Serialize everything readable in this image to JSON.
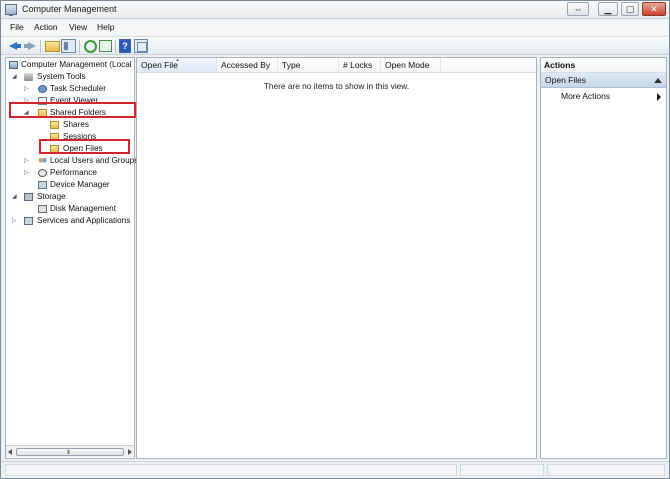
{
  "window": {
    "title": "Computer Management"
  },
  "menu": {
    "items": [
      "File",
      "Action",
      "View",
      "Help"
    ]
  },
  "toolbar": {
    "buttons": [
      "back-arrow-icon",
      "forward-arrow-icon",
      "up-folder-icon",
      "show-hide-tree-icon",
      "refresh-icon",
      "export-list-icon",
      "help-icon",
      "properties-window-icon"
    ]
  },
  "tree": {
    "root": "Computer Management (Local",
    "items": [
      {
        "label": "System Tools",
        "expander": "◢"
      },
      {
        "label": "Task Scheduler",
        "expander": "▷"
      },
      {
        "label": "Event Viewer",
        "expander": "▷"
      },
      {
        "label": "Shared Folders",
        "expander": "◢"
      },
      {
        "label": "Shares",
        "expander": ""
      },
      {
        "label": "Sessions",
        "expander": ""
      },
      {
        "label": "Open Files",
        "expander": ""
      },
      {
        "label": "Local Users and Groups",
        "expander": "▷"
      },
      {
        "label": "Performance",
        "expander": "▷"
      },
      {
        "label": "Device Manager",
        "expander": ""
      },
      {
        "label": "Storage",
        "expander": "◢"
      },
      {
        "label": "Disk Management",
        "expander": ""
      },
      {
        "label": "Services and Applications",
        "expander": "▷"
      }
    ],
    "root_expander": "◢",
    "scroll_grip": "III"
  },
  "list": {
    "columns": [
      "Open File",
      "Accessed By",
      "Type",
      "# Locks",
      "Open Mode"
    ],
    "sort_indicator": "▲",
    "empty_message": "There are no items to show in this view."
  },
  "actions": {
    "title": "Actions",
    "section": "Open Files",
    "items": [
      "More Actions"
    ]
  },
  "colors": {
    "highlight": "#d3242c",
    "accent": "#2f71c1"
  }
}
